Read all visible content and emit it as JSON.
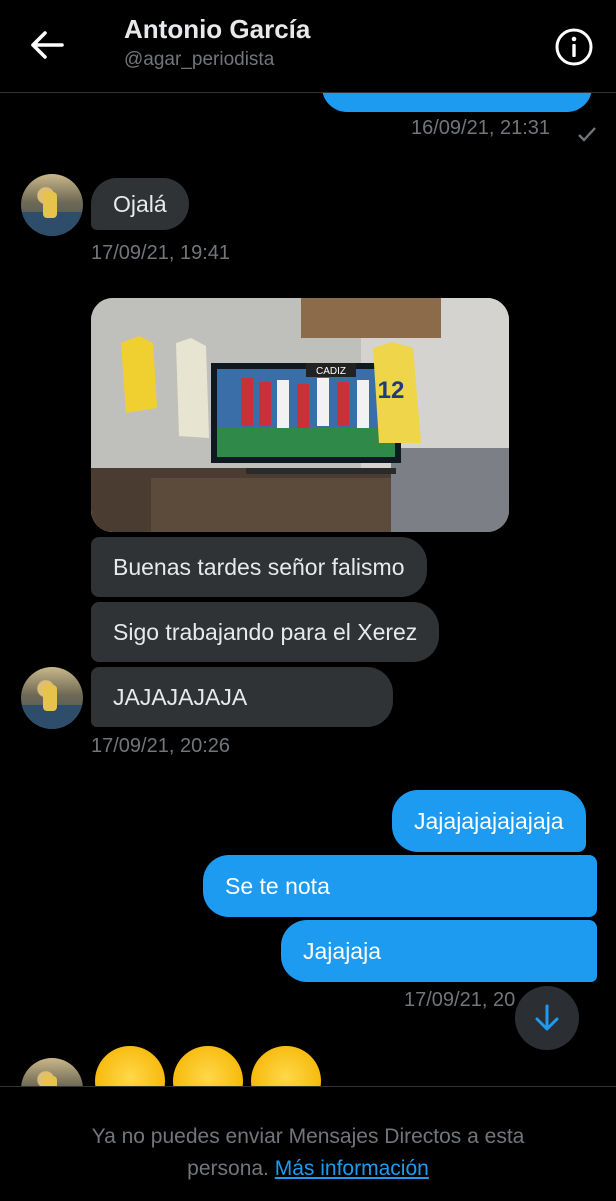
{
  "header": {
    "name": "Antonio García",
    "handle": "@agar_periodista",
    "back_icon": "arrow-left-icon",
    "info_icon": "info-circle-icon"
  },
  "messages": {
    "first_timestamp": "16/09/21, 21:31",
    "m1_text": "Ojalá",
    "m1_time": "17/09/21, 19:41",
    "photo_jersey_left": "",
    "photo_jersey_right_number": "12",
    "photo_tv_banner": "CADIZ",
    "m2_text": "Buenas tardes señor falismo",
    "m3_text": "Sigo trabajando para el Xerez",
    "m4_text": "JAJAJAJAJA",
    "m4_time": "17/09/21, 20:26",
    "out1_text": "Jajajajajajajaja",
    "out2_text": "Se te nota",
    "out3_text": "Jajajaja",
    "out_time": "17/09/21, 20",
    "emojis": [
      "😂",
      "😂",
      "😂"
    ]
  },
  "footer": {
    "text": "Ya no puedes enviar Mensajes Directos a esta persona.",
    "link": "Más información"
  },
  "colors": {
    "accent": "#1d9bf0",
    "incoming_bubble": "#2f3336",
    "background": "#000000",
    "muted_text": "#71767b"
  }
}
